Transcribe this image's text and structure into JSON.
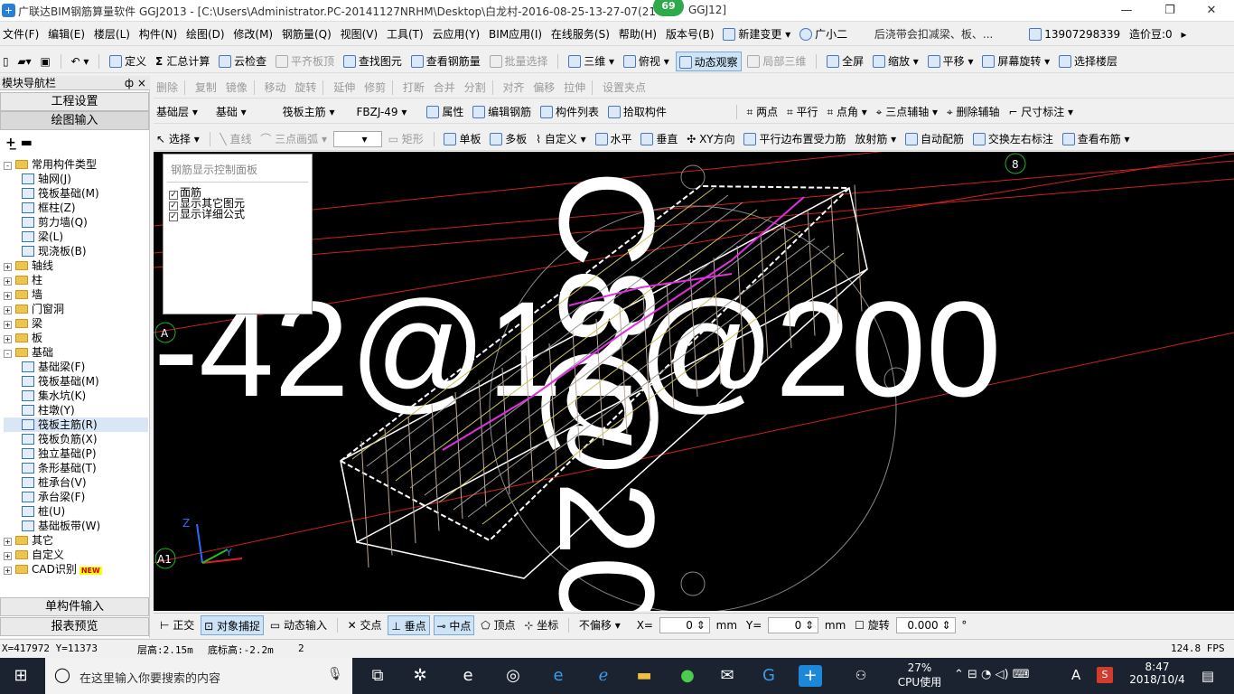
{
  "window": {
    "title": "广联达BIM钢筋算量软件 GGJ2013 - [C:\\Users\\Administrator.PC-20141127NRHM\\Desktop\\白龙村-2016-08-25-13-27-07(21",
    "title_tail": "GGJ12]",
    "badge": "69"
  },
  "menu": {
    "items": [
      "文件(F)",
      "编辑(E)",
      "楼层(L)",
      "构件(N)",
      "绘图(D)",
      "修改(M)",
      "钢筋量(Q)",
      "视图(V)",
      "工具(T)",
      "云应用(Y)",
      "BIM应用(I)",
      "在线服务(S)",
      "帮助(H)",
      "版本号(B)"
    ],
    "new_change": "新建变更",
    "assistant": "广小二",
    "notice": "后浇带会扣减梁、板、...",
    "phone": "13907298339",
    "price_bean": "造价豆:0"
  },
  "toolbar1": {
    "define": "定义",
    "sum": "汇总计算",
    "cloud_check": "云检查",
    "align_top": "平齐板顶",
    "find": "查找图元",
    "view_rebar": "查看钢筋量",
    "batch_select": "批量选择",
    "three_d": "三维",
    "top_view": "俯视",
    "dynamic_view": "动态观察",
    "local_3d": "局部三维",
    "fullscreen": "全屏",
    "zoom": "缩放",
    "pan": "平移",
    "rotate_screen": "屏幕旋转",
    "select_floor": "选择楼层"
  },
  "toolbar2": {
    "items": [
      "删除",
      "复制",
      "镜像",
      "移动",
      "旋转",
      "延伸",
      "修剪",
      "打断",
      "合并",
      "分割",
      "对齐",
      "偏移",
      "拉伸",
      "设置夹点"
    ]
  },
  "toolbar3": {
    "floor": "基础层",
    "type": "基础",
    "component": "筏板主筋",
    "code": "FBZJ-49",
    "attr": "属性",
    "edit_rebar": "编辑钢筋",
    "comp_list": "构件列表",
    "pick": "拾取构件",
    "two_points": "两点",
    "parallel": "平行",
    "point_angle": "点角",
    "three_point_axis": "三点辅轴",
    "delete_axis": "删除辅轴",
    "dim": "尺寸标注"
  },
  "toolbar4": {
    "select": "选择",
    "line": "直线",
    "arc": "三点画弧",
    "rect": "矩形",
    "single": "单板",
    "multi": "多板",
    "custom": "自定义",
    "horizontal": "水平",
    "vertical": "垂直",
    "xy": "XY方向",
    "parallel_edge": "平行边布置受力筋",
    "radial": "放射筋",
    "auto": "自动配筋",
    "swap": "交换左右标注",
    "view_layout": "查看布筋"
  },
  "nav": {
    "header": "模块导航栏",
    "pin": "ф ×",
    "proj_settings": "工程设置",
    "draw_input": "绘图输入",
    "tree": [
      {
        "label": "常用构件类型",
        "level": 0,
        "kind": "folder",
        "open": true
      },
      {
        "label": "轴网(J)",
        "level": 1,
        "kind": "leaf"
      },
      {
        "label": "筏板基础(M)",
        "level": 1,
        "kind": "leaf"
      },
      {
        "label": "框柱(Z)",
        "level": 1,
        "kind": "leaf"
      },
      {
        "label": "剪力墙(Q)",
        "level": 1,
        "kind": "leaf"
      },
      {
        "label": "梁(L)",
        "level": 1,
        "kind": "leaf"
      },
      {
        "label": "现浇板(B)",
        "level": 1,
        "kind": "leaf"
      },
      {
        "label": "轴线",
        "level": 0,
        "kind": "folder"
      },
      {
        "label": "柱",
        "level": 0,
        "kind": "folder"
      },
      {
        "label": "墙",
        "level": 0,
        "kind": "folder"
      },
      {
        "label": "门窗洞",
        "level": 0,
        "kind": "folder"
      },
      {
        "label": "梁",
        "level": 0,
        "kind": "folder"
      },
      {
        "label": "板",
        "level": 0,
        "kind": "folder"
      },
      {
        "label": "基础",
        "level": 0,
        "kind": "folder",
        "open": true
      },
      {
        "label": "基础梁(F)",
        "level": 1,
        "kind": "leaf"
      },
      {
        "label": "筏板基础(M)",
        "level": 1,
        "kind": "leaf"
      },
      {
        "label": "集水坑(K)",
        "level": 1,
        "kind": "leaf"
      },
      {
        "label": "柱墩(Y)",
        "level": 1,
        "kind": "leaf"
      },
      {
        "label": "筏板主筋(R)",
        "level": 1,
        "kind": "leaf",
        "selected": true
      },
      {
        "label": "筏板负筋(X)",
        "level": 1,
        "kind": "leaf"
      },
      {
        "label": "独立基础(P)",
        "level": 1,
        "kind": "leaf"
      },
      {
        "label": "条形基础(T)",
        "level": 1,
        "kind": "leaf"
      },
      {
        "label": "桩承台(V)",
        "level": 1,
        "kind": "leaf"
      },
      {
        "label": "承台梁(F)",
        "level": 1,
        "kind": "leaf"
      },
      {
        "label": "桩(U)",
        "level": 1,
        "kind": "leaf"
      },
      {
        "label": "基础板带(W)",
        "level": 1,
        "kind": "leaf"
      },
      {
        "label": "其它",
        "level": 0,
        "kind": "folder"
      },
      {
        "label": "自定义",
        "level": 0,
        "kind": "folder"
      },
      {
        "label": "CAD识别",
        "level": 0,
        "kind": "folder",
        "badge": "NEW"
      }
    ],
    "single_input": "单构件输入",
    "report": "报表预览"
  },
  "panel": {
    "title": "钢筋显示控制面板",
    "opts": [
      "面筋",
      "显示其它图元",
      "显示详细公式"
    ]
  },
  "canvas": {
    "big_text": "-42@12@200",
    "big_text2": "C8@20",
    "axis_a": "A",
    "axis_a1": "A1",
    "axis_8": "8",
    "axis_z": "Z",
    "axis_y": "Y"
  },
  "snap": {
    "ortho": "正交",
    "snap": "对象捕捉",
    "dyn": "动态输入",
    "intersect": "交点",
    "perp": "垂点",
    "mid": "中点",
    "vertex": "顶点",
    "coord": "坐标",
    "offset_mode": "不偏移",
    "x_label": "X=",
    "x_val": "0",
    "mm1": "mm",
    "y_label": "Y=",
    "y_val": "0",
    "mm2": "mm",
    "rotate": "旋转",
    "rot_val": "0.000",
    "deg": "°"
  },
  "status": {
    "coords": "X=417972 Y=11373",
    "floor_h": "层高:2.15m",
    "bottom_h": "底标高:-2.2m",
    "num": "2",
    "fps": "124.8 FPS"
  },
  "taskbar": {
    "search": "在这里输入你要搜索的内容",
    "cpu": "27%",
    "cpu_label": "CPU使用",
    "ime": "A",
    "time": "8:47",
    "date": "2018/10/4"
  }
}
